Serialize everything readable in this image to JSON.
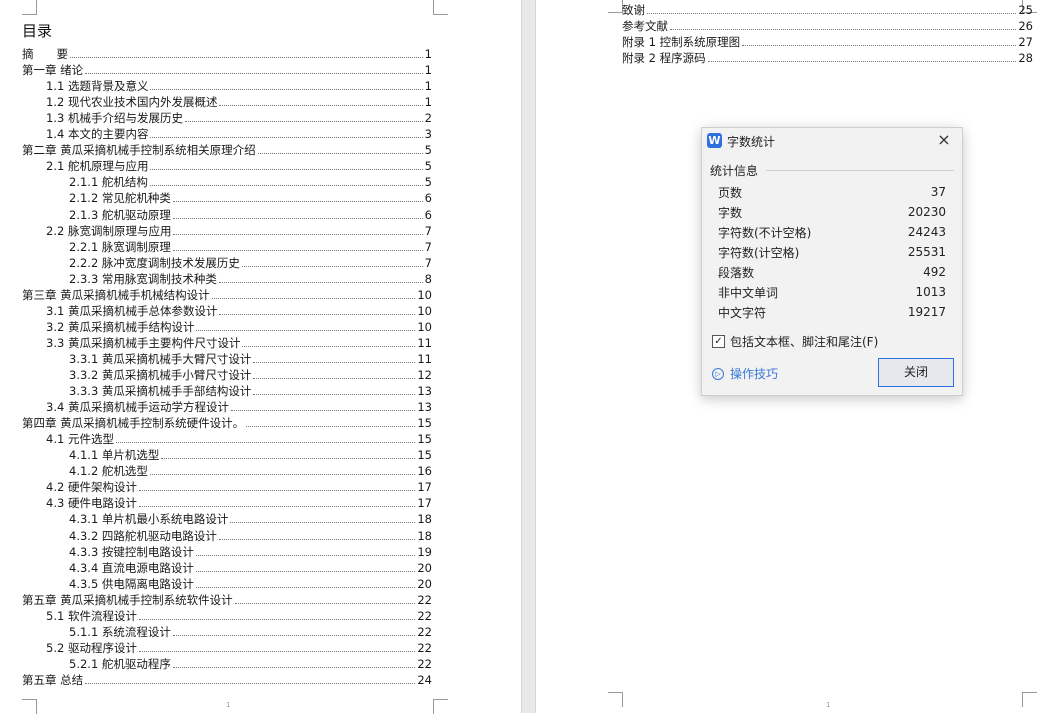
{
  "left_page": {
    "title": "目录",
    "page_number": "1",
    "entries": [
      {
        "label": "摘　　要",
        "page": "1"
      },
      {
        "label": "第一章 绪论",
        "page": "1"
      },
      {
        "label": "1.1 选题背景及意义",
        "page": "1"
      },
      {
        "label": "1.2 现代农业技术国内外发展概述",
        "page": "1"
      },
      {
        "label": "1.3 机械手介绍与发展历史",
        "page": "2"
      },
      {
        "label": "1.4 本文的主要内容",
        "page": "3"
      },
      {
        "label": "第二章 黄瓜采摘机械手控制系统相关原理介绍",
        "page": "5"
      },
      {
        "label": "2.1 舵机原理与应用",
        "page": "5"
      },
      {
        "label": "2.1.1 舵机结构",
        "page": "5"
      },
      {
        "label": "2.1.2 常见舵机种类",
        "page": "6"
      },
      {
        "label": "2.1.3 舵机驱动原理",
        "page": "6"
      },
      {
        "label": "2.2 脉宽调制原理与应用",
        "page": "7"
      },
      {
        "label": "2.2.1 脉宽调制原理",
        "page": "7"
      },
      {
        "label": "2.2.2 脉冲宽度调制技术发展历史",
        "page": "7"
      },
      {
        "label": "2.3.3 常用脉宽调制技术种类",
        "page": "8"
      },
      {
        "label": "第三章 黄瓜采摘机械手机械结构设计",
        "page": "10"
      },
      {
        "label": "3.1 黄瓜采摘机械手总体参数设计",
        "page": "10"
      },
      {
        "label": "3.2 黄瓜采摘机械手结构设计",
        "page": "10"
      },
      {
        "label": "3.3 黄瓜采摘机械手主要构件尺寸设计",
        "page": "11"
      },
      {
        "label": "3.3.1 黄瓜采摘机械手大臂尺寸设计",
        "page": "11"
      },
      {
        "label": "3.3.2 黄瓜采摘机械手小臂尺寸设计",
        "page": "12"
      },
      {
        "label": "3.3.3 黄瓜采摘机械手手部结构设计",
        "page": "13"
      },
      {
        "label": "3.4 黄瓜采摘机械手运动学方程设计",
        "page": "13"
      },
      {
        "label": "第四章 黄瓜采摘机械手控制系统硬件设计。",
        "page": "15"
      },
      {
        "label": "4.1 元件选型",
        "page": "15"
      },
      {
        "label": "4.1.1 单片机选型",
        "page": "15"
      },
      {
        "label": "4.1.2 舵机选型",
        "page": "16"
      },
      {
        "label": "4.2 硬件架构设计",
        "page": "17"
      },
      {
        "label": "4.3 硬件电路设计",
        "page": "17"
      },
      {
        "label": "4.3.1 单片机最小系统电路设计",
        "page": "18"
      },
      {
        "label": "4.3.2 四路舵机驱动电路设计",
        "page": "18"
      },
      {
        "label": "4.3.3 按键控制电路设计",
        "page": "19"
      },
      {
        "label": "4.3.4 直流电源电路设计",
        "page": "20"
      },
      {
        "label": "4.3.5 供电隔离电路设计",
        "page": "20"
      },
      {
        "label": "第五章 黄瓜采摘机械手控制系统软件设计",
        "page": "22"
      },
      {
        "label": "5.1 软件流程设计",
        "page": "22"
      },
      {
        "label": "5.1.1 系统流程设计",
        "page": "22"
      },
      {
        "label": "5.2 驱动程序设计",
        "page": "22"
      },
      {
        "label": "5.2.1 舵机驱动程序",
        "page": "22"
      },
      {
        "label": "第五章 总结",
        "page": "24"
      }
    ]
  },
  "right_page": {
    "page_number": "1",
    "entries": [
      {
        "label": "致谢",
        "page": "25"
      },
      {
        "label": "参考文献",
        "page": "26"
      },
      {
        "label": "附录 1 控制系统原理图",
        "page": "27"
      },
      {
        "label": "附录 2 程序源码",
        "page": "28"
      }
    ]
  },
  "dialog": {
    "logo_text": "W",
    "title": "字数统计",
    "close_icon": "×",
    "section_label": "统计信息",
    "stats": [
      {
        "label": "页数",
        "value": "37"
      },
      {
        "label": "字数",
        "value": "20230"
      },
      {
        "label": "字符数(不计空格)",
        "value": "24243"
      },
      {
        "label": "字符数(计空格)",
        "value": "25531"
      },
      {
        "label": "段落数",
        "value": "492"
      },
      {
        "label": "非中文单词",
        "value": "1013"
      },
      {
        "label": "中文字符",
        "value": "19217"
      }
    ],
    "checkbox_label": "包括文本框、脚注和尾注(F)",
    "checkbox_checked": "✓",
    "tips_icon": "▷",
    "tips_label": "操作技巧",
    "close_button": "关闭",
    "accent_color": "#2f6fe0"
  }
}
